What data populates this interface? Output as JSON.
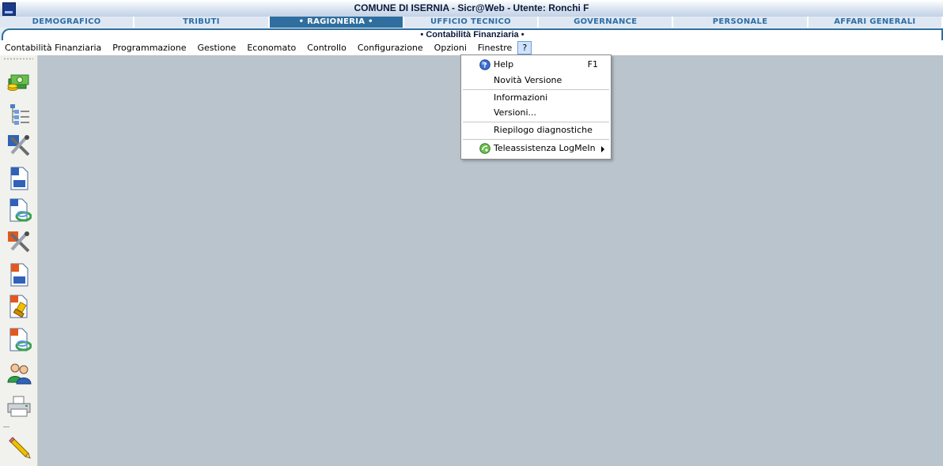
{
  "window": {
    "title": "COMUNE DI ISERNIA  -  Sicr@Web  -  Utente: Ronchi F"
  },
  "modules": [
    {
      "label": "DEMOGRAFICO",
      "active": false
    },
    {
      "label": "TRIBUTI",
      "active": false
    },
    {
      "label": "• RAGIONERIA •",
      "active": true
    },
    {
      "label": "UFFICIO TECNICO",
      "active": false
    },
    {
      "label": "GOVERNANCE",
      "active": false
    },
    {
      "label": "PERSONALE",
      "active": false
    },
    {
      "label": "AFFARI GENERALI",
      "active": false
    }
  ],
  "subheader": {
    "label": "• Contabilità Finanziaria •"
  },
  "menubar": {
    "items": [
      {
        "label": "Contabilità Finanziaria"
      },
      {
        "label": "Programmazione"
      },
      {
        "label": "Gestione"
      },
      {
        "label": "Economato"
      },
      {
        "label": "Controllo"
      },
      {
        "label": "Configurazione"
      },
      {
        "label": "Opzioni"
      },
      {
        "label": "Finestre"
      },
      {
        "label": "?"
      }
    ]
  },
  "help_menu": {
    "items": [
      {
        "label": "Help",
        "shortcut": "F1",
        "icon": "help-icon"
      },
      {
        "label": "Novità Versione"
      },
      {
        "label": "Informazioni"
      },
      {
        "label": "Versioni..."
      },
      {
        "label": "Riepilogo diagnostiche"
      },
      {
        "label": "Teleassistenza LogMeIn",
        "icon": "logmein-icon",
        "submenu": true
      }
    ]
  },
  "toolbar": {
    "buttons": [
      "money-icon",
      "tree-list-icon",
      "tools-document-icon",
      "document-icon",
      "document-swirl-icon",
      "tools-red-icon",
      "document-red-icon",
      "document-stamp-icon",
      "document-swirl-red-icon",
      "users-icon",
      "printer-icon",
      "pencil-icon"
    ]
  },
  "colors": {
    "accent": "#2f6e9e",
    "workspace": "#b9c4cc",
    "module_text": "#2c6ea8"
  }
}
